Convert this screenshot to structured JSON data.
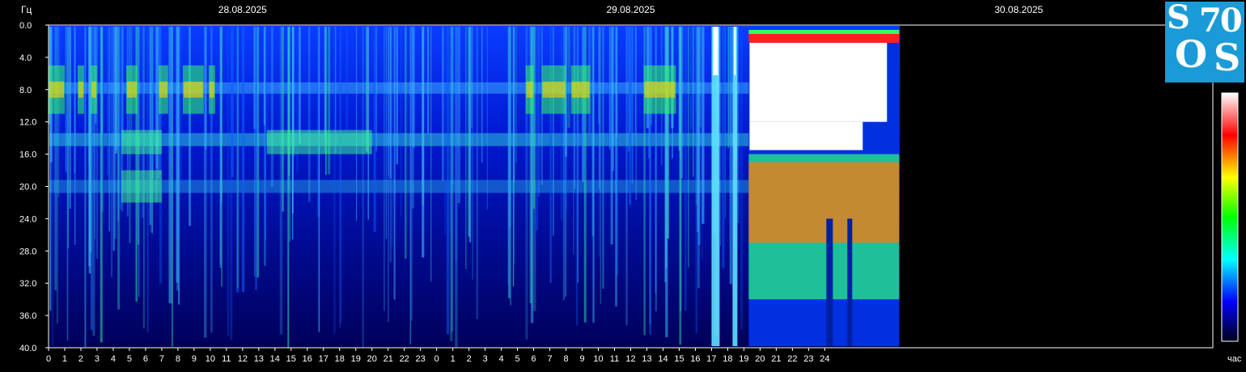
{
  "chart_data": {
    "type": "heatmap",
    "ylabel": "Гц",
    "xlabel": "час",
    "yticks": [
      "0.0",
      "4.0",
      "8.0",
      "12.0",
      "16.0",
      "20.0",
      "24.0",
      "28.0",
      "32.0",
      "36.0",
      "40.0"
    ],
    "ylim": [
      0,
      40
    ],
    "xticks_hours": [
      "0",
      "1",
      "2",
      "3",
      "4",
      "5",
      "6",
      "7",
      "8",
      "9",
      "10",
      "11",
      "12",
      "13",
      "14",
      "15",
      "16",
      "17",
      "18",
      "19",
      "20",
      "21",
      "22",
      "23",
      "0",
      "1",
      "2",
      "3",
      "4",
      "5",
      "6",
      "7",
      "8",
      "9",
      "10",
      "11",
      "12",
      "13",
      "14",
      "15",
      "16",
      "17",
      "18",
      "19",
      "20",
      "21",
      "22",
      "23",
      "24"
    ],
    "dates": [
      "28.08.2025",
      "29.08.2025",
      "30.08.2025"
    ],
    "data_end_hour": 52.6,
    "total_hours": 72,
    "colorscale": [
      "#00001a",
      "#0000ff",
      "#00ffff",
      "#00ff00",
      "#ffff00",
      "#ff0000",
      "#ffffff"
    ],
    "bands": [
      {
        "name": "8 Hz",
        "freq": 7.8,
        "start": 0,
        "end": 52.6
      },
      {
        "name": "14 Hz",
        "freq": 14.2,
        "start": 0,
        "end": 52.6
      },
      {
        "name": "20 Hz",
        "freq": 20.0,
        "start": 0,
        "end": 52.6
      }
    ],
    "disturbed_interval": [
      43.3,
      52.6
    ]
  },
  "logo": {
    "l1": "S",
    "l2": "70",
    "l3": "O",
    "l4": "S"
  }
}
